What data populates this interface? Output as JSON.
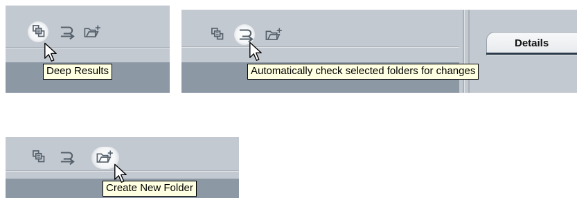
{
  "panels": [
    {
      "tooltip": "Deep Results",
      "icons": [
        "deep-results-icon",
        "auto-check-icon",
        "new-folder-icon"
      ],
      "highlighted": "deep-results-icon"
    },
    {
      "tooltip": "Automatically check selected folders for changes",
      "icons": [
        "deep-results-icon",
        "auto-check-icon",
        "new-folder-icon"
      ],
      "highlighted": "auto-check-icon",
      "tab_label": "Details"
    },
    {
      "tooltip": "Create New Folder",
      "icons": [
        "deep-results-icon",
        "auto-check-icon",
        "new-folder-icon"
      ],
      "highlighted": "new-folder-icon"
    }
  ],
  "colors": {
    "toolbar_bg": "#c3c9d0",
    "band_bg": "#8d98a5",
    "tooltip_bg": "#ffffe1"
  }
}
